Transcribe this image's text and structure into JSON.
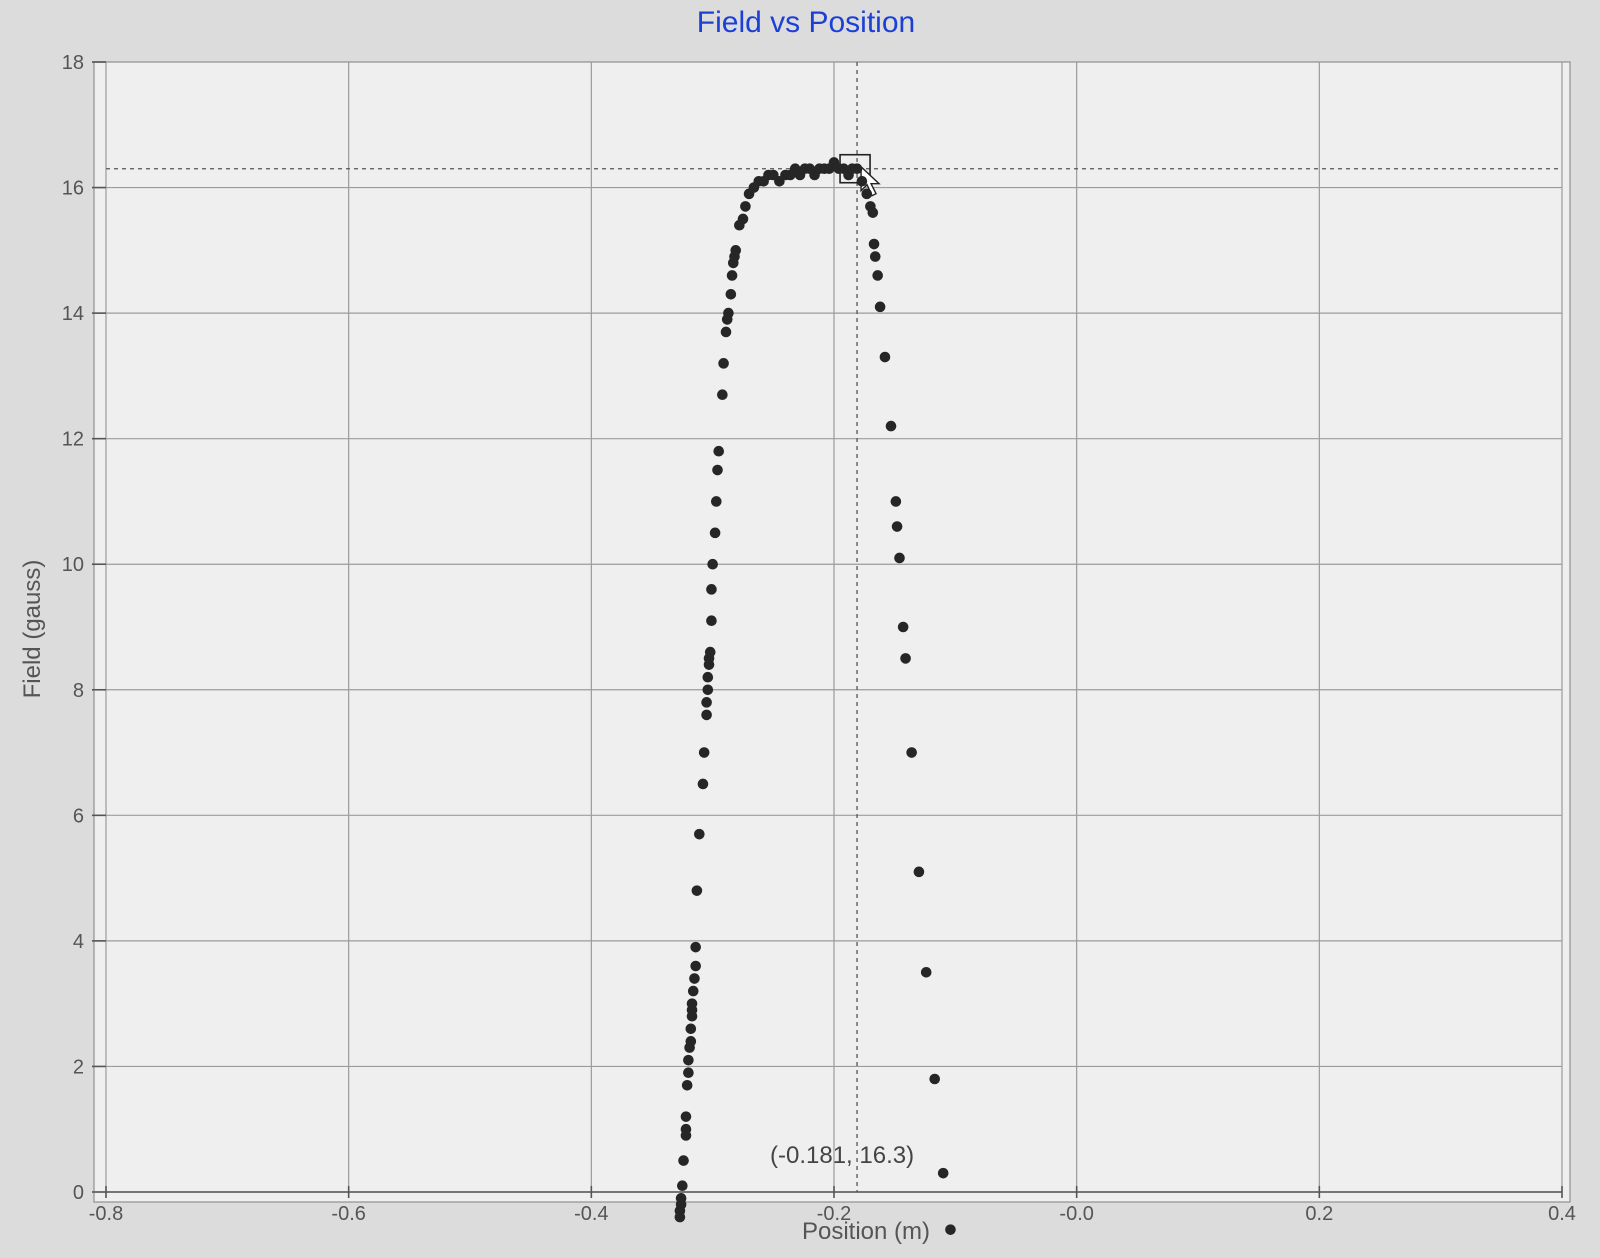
{
  "window": {
    "title": "Field vs Position"
  },
  "chart_data": {
    "type": "scatter",
    "title": "Field vs Position",
    "xlabel": "Position (m)",
    "ylabel": "Field (gauss)",
    "xlim": [
      -0.8,
      0.4
    ],
    "ylim": [
      0,
      18
    ],
    "x_ticks": [
      -0.8,
      -0.6,
      -0.4,
      -0.2,
      0.0,
      0.2,
      0.4
    ],
    "x_tick_labels": [
      "-0.8",
      "-0.6",
      "-0.4",
      "-0.2",
      "-0.0",
      "0.2",
      "0.4"
    ],
    "y_ticks": [
      0,
      2,
      4,
      6,
      8,
      10,
      12,
      14,
      16,
      18
    ],
    "y_tick_labels": [
      "0",
      "2",
      "4",
      "6",
      "8",
      "10",
      "12",
      "14",
      "16",
      "18"
    ],
    "grid": true,
    "point_color": "#262626",
    "title_color": "#1c3fd6",
    "cursor": {
      "x": -0.181,
      "y": 16.3,
      "label": "(-0.181, 16.3)"
    },
    "series": [
      {
        "points": [
          [
            -0.327,
            -0.4
          ],
          [
            -0.327,
            -0.3
          ],
          [
            -0.326,
            -0.2
          ],
          [
            -0.326,
            -0.1
          ],
          [
            -0.325,
            0.1
          ],
          [
            -0.324,
            0.5
          ],
          [
            -0.322,
            0.9
          ],
          [
            -0.322,
            1.0
          ],
          [
            -0.322,
            1.2
          ],
          [
            -0.321,
            1.7
          ],
          [
            -0.32,
            1.9
          ],
          [
            -0.32,
            2.1
          ],
          [
            -0.319,
            2.3
          ],
          [
            -0.318,
            2.4
          ],
          [
            -0.318,
            2.6
          ],
          [
            -0.317,
            2.8
          ],
          [
            -0.317,
            2.9
          ],
          [
            -0.317,
            3.0
          ],
          [
            -0.316,
            3.2
          ],
          [
            -0.315,
            3.4
          ],
          [
            -0.314,
            3.6
          ],
          [
            -0.314,
            3.9
          ],
          [
            -0.313,
            4.8
          ],
          [
            -0.311,
            5.7
          ],
          [
            -0.308,
            6.5
          ],
          [
            -0.307,
            7.0
          ],
          [
            -0.305,
            7.6
          ],
          [
            -0.305,
            7.8
          ],
          [
            -0.304,
            8.0
          ],
          [
            -0.304,
            8.2
          ],
          [
            -0.303,
            8.4
          ],
          [
            -0.303,
            8.5
          ],
          [
            -0.302,
            8.6
          ],
          [
            -0.301,
            9.1
          ],
          [
            -0.301,
            9.6
          ],
          [
            -0.3,
            10.0
          ],
          [
            -0.298,
            10.5
          ],
          [
            -0.297,
            11.0
          ],
          [
            -0.296,
            11.5
          ],
          [
            -0.295,
            11.8
          ],
          [
            -0.292,
            12.7
          ],
          [
            -0.291,
            13.2
          ],
          [
            -0.289,
            13.7
          ],
          [
            -0.288,
            13.9
          ],
          [
            -0.287,
            14.0
          ],
          [
            -0.285,
            14.3
          ],
          [
            -0.284,
            14.6
          ],
          [
            -0.283,
            14.8
          ],
          [
            -0.282,
            14.9
          ],
          [
            -0.281,
            15.0
          ],
          [
            -0.278,
            15.4
          ],
          [
            -0.275,
            15.5
          ],
          [
            -0.273,
            15.7
          ],
          [
            -0.27,
            15.9
          ],
          [
            -0.266,
            16.0
          ],
          [
            -0.262,
            16.1
          ],
          [
            -0.258,
            16.1
          ],
          [
            -0.254,
            16.2
          ],
          [
            -0.25,
            16.2
          ],
          [
            -0.245,
            16.1
          ],
          [
            -0.24,
            16.2
          ],
          [
            -0.236,
            16.2
          ],
          [
            -0.232,
            16.3
          ],
          [
            -0.228,
            16.2
          ],
          [
            -0.224,
            16.3
          ],
          [
            -0.22,
            16.3
          ],
          [
            -0.216,
            16.2
          ],
          [
            -0.212,
            16.3
          ],
          [
            -0.208,
            16.3
          ],
          [
            -0.204,
            16.3
          ],
          [
            -0.2,
            16.4
          ],
          [
            -0.196,
            16.3
          ],
          [
            -0.192,
            16.3
          ],
          [
            -0.188,
            16.2
          ],
          [
            -0.185,
            16.3
          ],
          [
            -0.181,
            16.3
          ],
          [
            -0.177,
            16.1
          ],
          [
            -0.173,
            15.9
          ],
          [
            -0.17,
            15.7
          ],
          [
            -0.168,
            15.6
          ],
          [
            -0.167,
            15.1
          ],
          [
            -0.166,
            14.9
          ],
          [
            -0.164,
            14.6
          ],
          [
            -0.162,
            14.1
          ],
          [
            -0.158,
            13.3
          ],
          [
            -0.153,
            12.2
          ],
          [
            -0.149,
            11.0
          ],
          [
            -0.148,
            10.6
          ],
          [
            -0.146,
            10.1
          ],
          [
            -0.143,
            9.0
          ],
          [
            -0.141,
            8.5
          ],
          [
            -0.136,
            7.0
          ],
          [
            -0.13,
            5.1
          ],
          [
            -0.124,
            3.5
          ],
          [
            -0.117,
            1.8
          ],
          [
            -0.11,
            0.3
          ],
          [
            -0.104,
            -0.6
          ]
        ]
      }
    ]
  }
}
